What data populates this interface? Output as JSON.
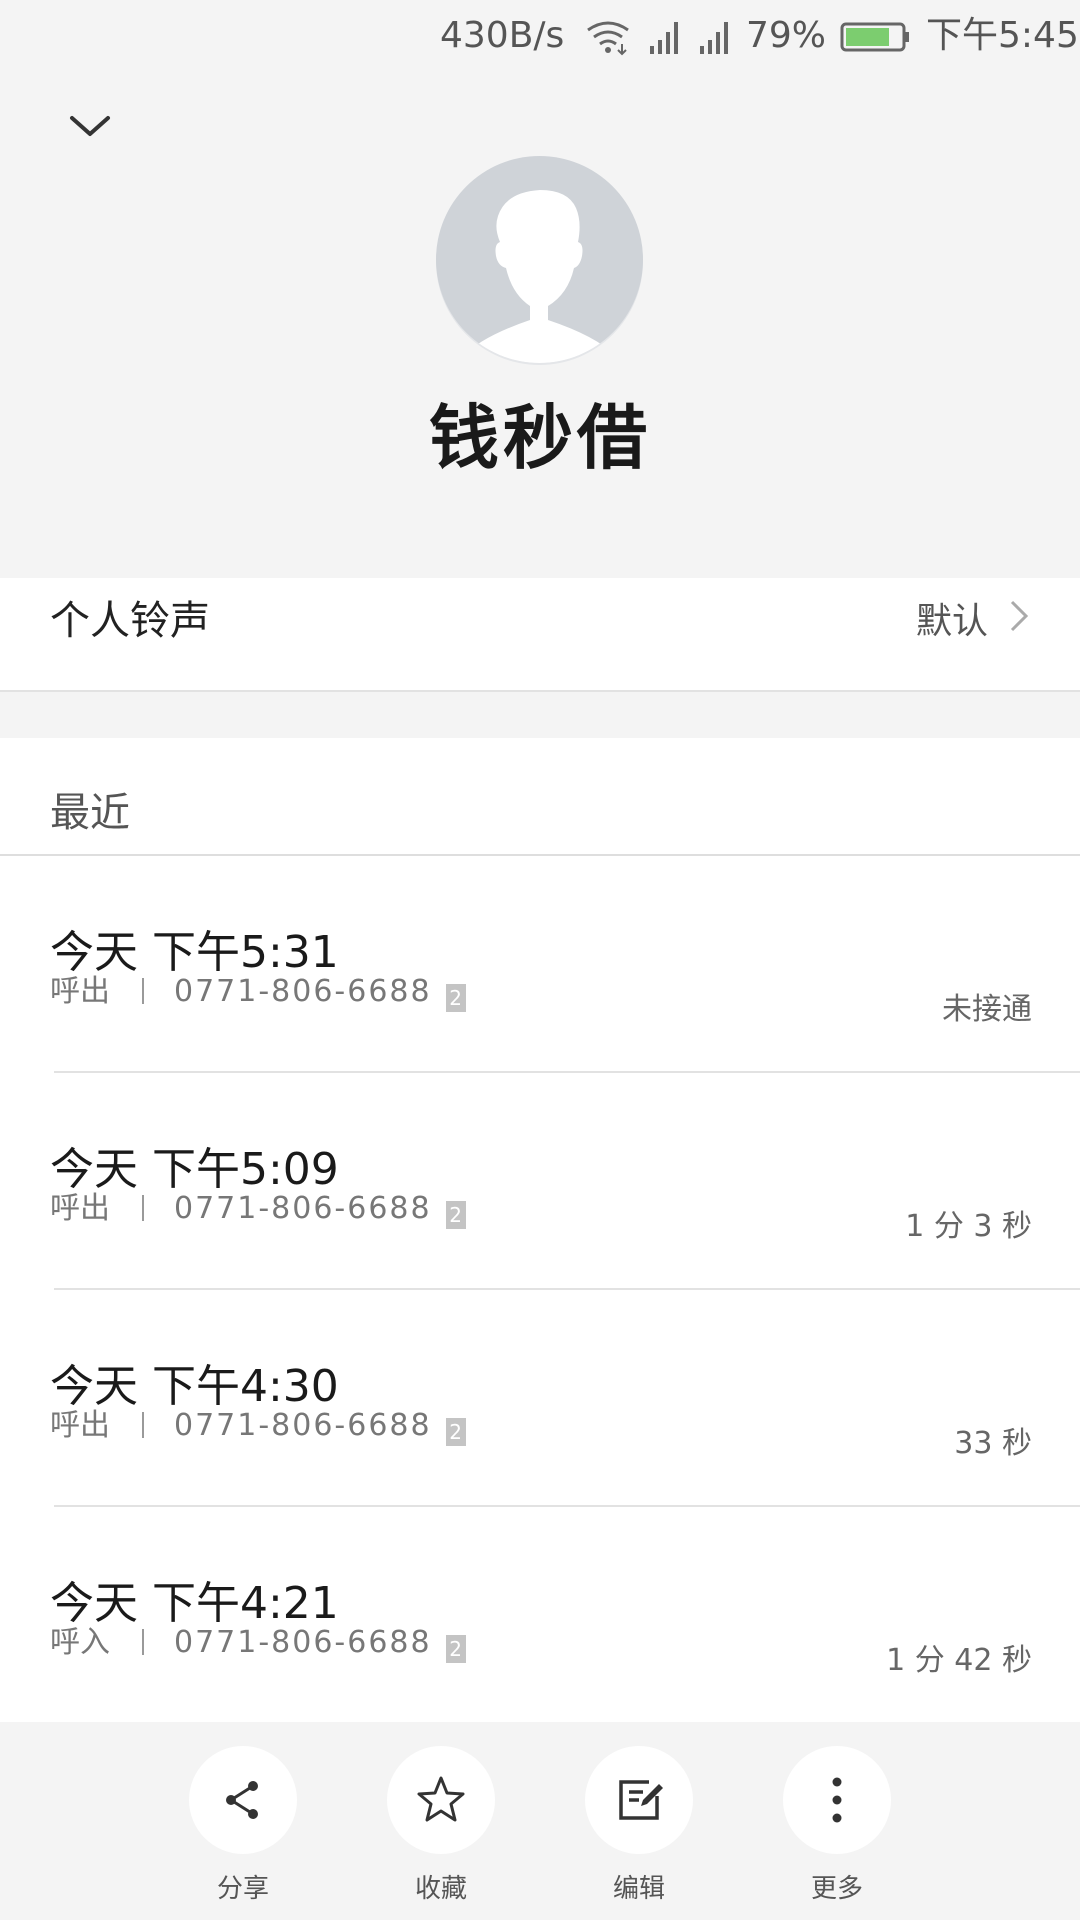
{
  "status_bar": {
    "speed": "430B/s",
    "battery_percent": "79%",
    "battery_level": 0.79,
    "time": "下午5:45",
    "icons": [
      "wifi-icon",
      "signal-icon",
      "signal-icon",
      "battery-icon"
    ]
  },
  "header": {
    "collapse_icon": "chevron-down-icon",
    "avatar_icon": "person-silhouette-icon",
    "contact_name": "钱秒借"
  },
  "ringtone": {
    "label": "个人铃声",
    "value": "默认",
    "icon": "chevron-right-icon"
  },
  "recent": {
    "title": "最近",
    "calls": [
      {
        "time": "今天 下午5:31",
        "direction": "呼出",
        "number": "0771-806-6688",
        "sim": "2",
        "duration": "未接通"
      },
      {
        "time": "今天 下午5:09",
        "direction": "呼出",
        "number": "0771-806-6688",
        "sim": "2",
        "duration": "1 分 3 秒"
      },
      {
        "time": "今天 下午4:30",
        "direction": "呼出",
        "number": "0771-806-6688",
        "sim": "2",
        "duration": "33 秒"
      },
      {
        "time": "今天 下午4:21",
        "direction": "呼入",
        "number": "0771-806-6688",
        "sim": "2",
        "duration": "1 分 42 秒"
      }
    ]
  },
  "actions": [
    {
      "label": "分享",
      "icon": "share-icon"
    },
    {
      "label": "收藏",
      "icon": "star-icon"
    },
    {
      "label": "编辑",
      "icon": "edit-icon"
    },
    {
      "label": "更多",
      "icon": "more-vertical-icon"
    }
  ],
  "colors": {
    "background_gray": "#f4f4f4",
    "battery_fill": "#7ccd6f",
    "avatar_bg": "#cfd3d8"
  }
}
